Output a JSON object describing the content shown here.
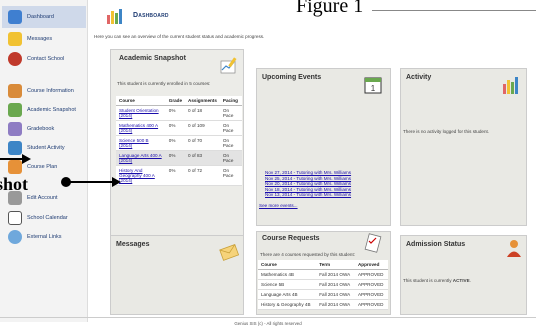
{
  "figure_label": "Figure 1",
  "overlay_label": "shot",
  "sidebar": {
    "items": [
      {
        "label": "Dashboard",
        "icon": "dashboard-icon",
        "active": true
      },
      {
        "label": "Messages",
        "icon": "messages-icon"
      },
      {
        "label": "Contact School",
        "icon": "contact-school-icon"
      },
      {
        "label": "Course Information",
        "icon": "course-information-icon"
      },
      {
        "label": "Academic Snapshot",
        "icon": "academic-snapshot-icon"
      },
      {
        "label": "Gradebook",
        "icon": "gradebook-icon"
      },
      {
        "label": "Student Activity",
        "icon": "student-activity-icon"
      },
      {
        "label": "Course Plan",
        "icon": "course-plan-icon"
      },
      {
        "label": "Edit Account",
        "icon": "edit-account-icon"
      },
      {
        "label": "School Calendar",
        "icon": "school-calendar-icon"
      },
      {
        "label": "External Links",
        "icon": "external-links-icon"
      }
    ]
  },
  "header": {
    "title": "Dashboard",
    "description": "Here you can see an overview of the current student status and academic progress."
  },
  "academic_snapshot": {
    "title": "Academic Snapshot",
    "note": "This student is currently enrolled in 5 courses:",
    "columns": [
      "Course",
      "Grade",
      "Assignments",
      "Pacing"
    ],
    "rows": [
      {
        "course": "Student Orientation (2014)",
        "grade": "0%",
        "assignments": "0 of 18",
        "pacing": "On Pace"
      },
      {
        "course": "Mathematics 400 A (2014)",
        "grade": "0%",
        "assignments": "0 of 109",
        "pacing": "On Pace"
      },
      {
        "course": "Science 500 B (2014)",
        "grade": "0%",
        "assignments": "0 of 70",
        "pacing": "On Pace"
      },
      {
        "course": "Language Arts 400 A (2014)",
        "grade": "0%",
        "assignments": "0 of 83",
        "pacing": "On Pace"
      },
      {
        "course": "History And Geography 400 A (2014)",
        "grade": "0%",
        "assignments": "0 of 72",
        "pacing": "On Pace"
      }
    ]
  },
  "upcoming_events": {
    "title": "Upcoming Events",
    "events": [
      "Nov 27, 2014 - Tutoring with Mrs. Williams",
      "Nov 25, 2014 - Tutoring with Mrs. Williams",
      "Nov 20, 2014 - Tutoring with Mrs. Williams",
      "Nov 18, 2014 - Tutoring with Mrs. Williams",
      "Nov 13, 2014 - Tutoring with Mrs. Williams"
    ],
    "more_link": "See more events..."
  },
  "activity": {
    "title": "Activity",
    "note": "There is no activity logged for this student."
  },
  "messages": {
    "title": "Messages"
  },
  "course_requests": {
    "title": "Course Requests",
    "note": "There are 4 courses requested by this student:",
    "columns": [
      "Course",
      "Term",
      "Approved"
    ],
    "rows": [
      {
        "course": "Mathematics 4B",
        "term": "Fall 2014 OWA",
        "approved": "APPROVED"
      },
      {
        "course": "Science 5B",
        "term": "Fall 2014 OWA",
        "approved": "APPROVED"
      },
      {
        "course": "Language Arts 4B",
        "term": "Fall 2014 OWA",
        "approved": "APPROVED"
      },
      {
        "course": "History & Geography 4B",
        "term": "Fall 2014 OWA",
        "approved": "APPROVED"
      }
    ]
  },
  "admission_status": {
    "title": "Admission Status",
    "note_prefix": "This student is currently ",
    "status": "ACTIVE",
    "note_suffix": "."
  },
  "footer": "Genius SIS (c) - All rights reserved",
  "colors": {
    "link": "#1a0dab",
    "nav_text": "#1f3c73",
    "panel_bg": "#e9e9e4",
    "active_nav": "#cfd9ea"
  }
}
